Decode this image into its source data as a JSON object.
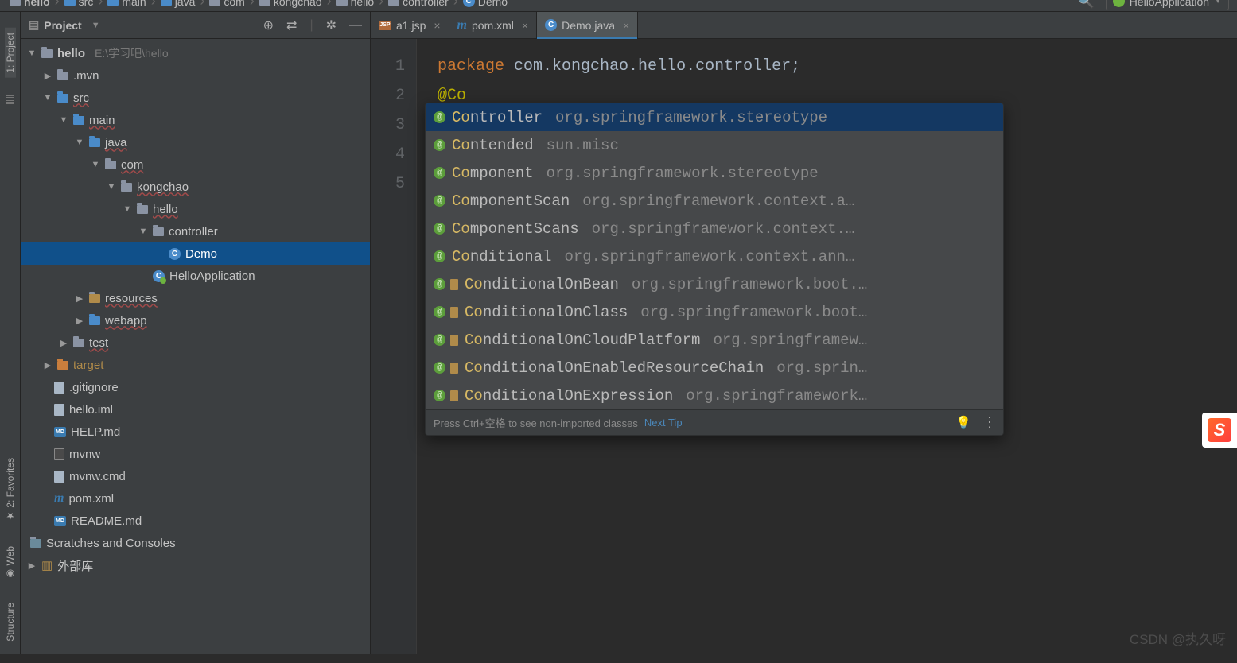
{
  "breadcrumb": [
    "hello",
    "src",
    "main",
    "java",
    "com",
    "kongchao",
    "hello",
    "controller",
    "Demo"
  ],
  "runConfig": "HelloApplication",
  "toolstrip": [
    "1: Project",
    "2: Favorites",
    "Web",
    "Structure"
  ],
  "projectPanel": {
    "title": "Project"
  },
  "tree": {
    "root": {
      "name": "hello",
      "path": "E:\\学习吧\\hello"
    },
    "mvn": ".mvn",
    "src": "src",
    "main": "main",
    "java": "java",
    "com": "com",
    "kongchao": "kongchao",
    "hellopkg": "hello",
    "controller": "controller",
    "demo": "Demo",
    "helloApp": "HelloApplication",
    "resources": "resources",
    "webapp": "webapp",
    "test": "test",
    "target": "target",
    "gitignore": ".gitignore",
    "helloiml": "hello.iml",
    "helpmd": "HELP.md",
    "mvnw": "mvnw",
    "mvnwcmd": "mvnw.cmd",
    "pomxml": "pom.xml",
    "readme": "README.md",
    "scratches": "Scratches and Consoles",
    "extlib": "外部库"
  },
  "tabs": [
    {
      "label": "a1.jsp",
      "type": "jsp"
    },
    {
      "label": "pom.xml",
      "type": "m"
    },
    {
      "label": "Demo.java",
      "type": "c",
      "active": true
    }
  ],
  "gutter": [
    "1",
    "2",
    "3",
    "4",
    "5"
  ],
  "code": {
    "kw": "package",
    "pkg": "com.kongchao.hello.controller",
    "anno": "@Co"
  },
  "completion": {
    "items": [
      {
        "head": "Co",
        "rest": "ntroller",
        "pkg": "org.springframework.stereotype",
        "boot": false,
        "hl": true
      },
      {
        "head": "Co",
        "rest": "ntended",
        "pkg": "sun.misc",
        "boot": false
      },
      {
        "head": "Co",
        "rest": "mponent",
        "pkg": "org.springframework.stereotype",
        "boot": false
      },
      {
        "head": "Co",
        "rest": "mponentScan",
        "pkg": "org.springframework.context.a…",
        "boot": false
      },
      {
        "head": "Co",
        "rest": "mponentScans",
        "pkg": "org.springframework.context.…",
        "boot": false
      },
      {
        "head": "Co",
        "rest": "nditional",
        "pkg": "org.springframework.context.ann…",
        "boot": false
      },
      {
        "head": "Co",
        "rest": "nditionalOnBean",
        "pkg": "org.springframework.boot.…",
        "boot": true
      },
      {
        "head": "Co",
        "rest": "nditionalOnClass",
        "pkg": "org.springframework.boot…",
        "boot": true
      },
      {
        "head": "Co",
        "rest": "nditionalOnCloudPlatform",
        "pkg": "org.springframew…",
        "boot": true
      },
      {
        "head": "Co",
        "rest": "nditionalOnEnabledResourceChain",
        "pkg": "org.sprin…",
        "boot": true
      },
      {
        "head": "Co",
        "rest": "nditionalOnExpression",
        "pkg": "org.springframework…",
        "boot": true
      }
    ],
    "footer": "Press Ctrl+空格 to see non-imported classes",
    "nextTip": "Next Tip"
  },
  "watermark": "CSDN @执久呀"
}
